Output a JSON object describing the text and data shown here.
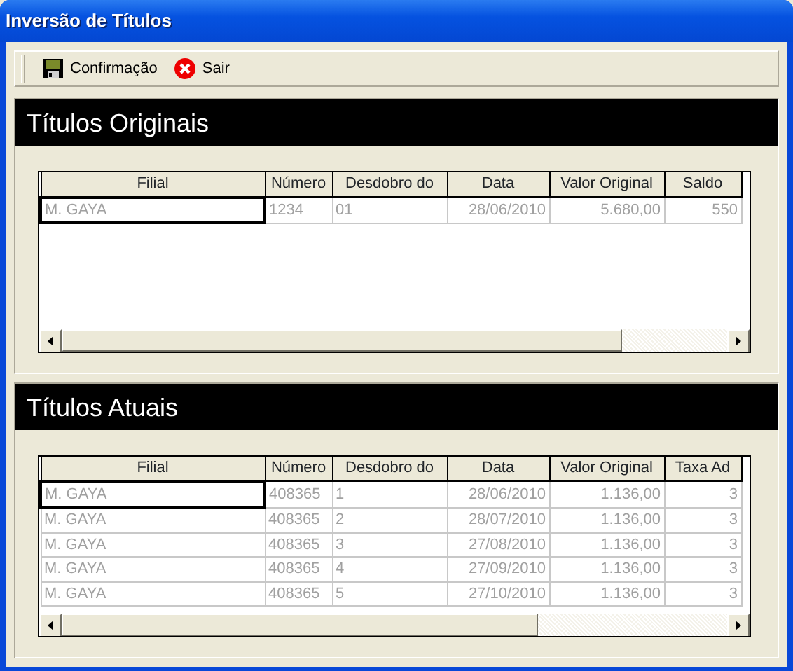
{
  "window": {
    "title": "Inversão de Títulos"
  },
  "toolbar": [
    {
      "kind": "save",
      "label": "Confirmação"
    },
    {
      "kind": "exit",
      "label": "Sair"
    }
  ],
  "sections": [
    {
      "title": "Títulos Originais",
      "table": {
        "columns": [
          "Filial",
          "Número",
          "Desdobro do",
          "Data",
          "Valor Original",
          "Saldo"
        ],
        "rows": [
          {
            "focused": true,
            "cells": [
              "M. GAYA",
              "1234",
              "01",
              "28/06/2010",
              "5.680,00",
              "550"
            ]
          }
        ]
      }
    },
    {
      "title": "Títulos Atuais",
      "table": {
        "columns": [
          "Filial",
          "Número",
          "Desdobro do",
          "Data",
          "Valor Original",
          "Taxa Ad"
        ],
        "rows": [
          {
            "focused": true,
            "cells": [
              "M. GAYA",
              "408365",
              "1",
              "28/06/2010",
              "1.136,00",
              "3"
            ]
          },
          {
            "focused": false,
            "cells": [
              "M. GAYA",
              "408365",
              "2",
              "28/07/2010",
              "1.136,00",
              "3"
            ]
          },
          {
            "focused": false,
            "cells": [
              "M. GAYA",
              "408365",
              "3",
              "27/08/2010",
              "1.136,00",
              "3"
            ]
          },
          {
            "focused": false,
            "cells": [
              "M. GAYA",
              "408365",
              "4",
              "27/09/2010",
              "1.136,00",
              "3"
            ]
          },
          {
            "focused": false,
            "cells": [
              "M. GAYA",
              "408365",
              "5",
              "27/10/2010",
              "1.136,00",
              "3"
            ]
          }
        ]
      }
    }
  ]
}
